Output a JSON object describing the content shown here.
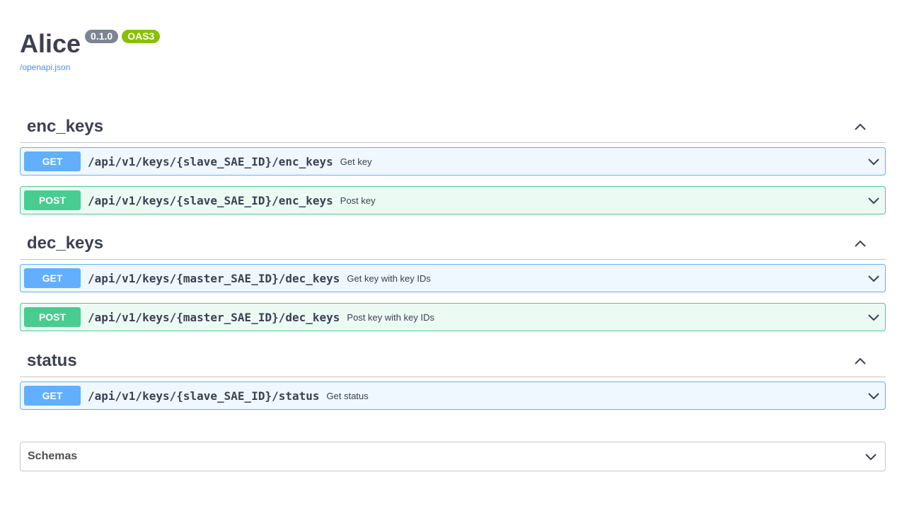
{
  "info": {
    "title": "Alice",
    "version": "0.1.0",
    "oas": "OAS3",
    "spec_link": "/openapi.json"
  },
  "sections": [
    {
      "name": "enc_keys",
      "operations": [
        {
          "method": "GET",
          "path": "/api/v1/keys/{slave_SAE_ID}/enc_keys",
          "summary": "Get key"
        },
        {
          "method": "POST",
          "path": "/api/v1/keys/{slave_SAE_ID}/enc_keys",
          "summary": "Post key"
        }
      ]
    },
    {
      "name": "dec_keys",
      "operations": [
        {
          "method": "GET",
          "path": "/api/v1/keys/{master_SAE_ID}/dec_keys",
          "summary": "Get key with key IDs"
        },
        {
          "method": "POST",
          "path": "/api/v1/keys/{master_SAE_ID}/dec_keys",
          "summary": "Post key with key IDs"
        }
      ]
    },
    {
      "name": "status",
      "operations": [
        {
          "method": "GET",
          "path": "/api/v1/keys/{slave_SAE_ID}/status",
          "summary": "Get status"
        }
      ]
    }
  ],
  "schemas": {
    "label": "Schemas"
  },
  "icons": {
    "collapse": "chevron-up-icon",
    "expand": "chevron-down-icon"
  },
  "colors": {
    "get": "#61affe",
    "post": "#49cc90",
    "version_badge": "#7d8492",
    "oas_badge": "#89bf04",
    "link": "#4990e2"
  }
}
